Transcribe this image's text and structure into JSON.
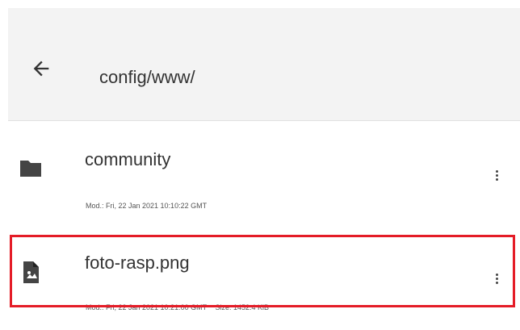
{
  "header": {
    "path": "config/www/"
  },
  "files": [
    {
      "name": "community",
      "type": "folder",
      "icon": "folder-icon",
      "modified": "Mod.: Fri, 22 Jan 2021 10:10:22 GMT",
      "size": ""
    },
    {
      "name": "foto-rasp.png",
      "type": "image",
      "icon": "image-file-icon",
      "modified": "Mod.: Fri, 22 Jan 2021 10:21:00 GMT",
      "size": "Size: 1452.4 KiB"
    }
  ],
  "icons": {
    "back": "arrow-left-icon",
    "more": "more-vertical-icon"
  },
  "colors": {
    "selection_border": "#e41c27",
    "header_background": "#f3f3f3"
  }
}
